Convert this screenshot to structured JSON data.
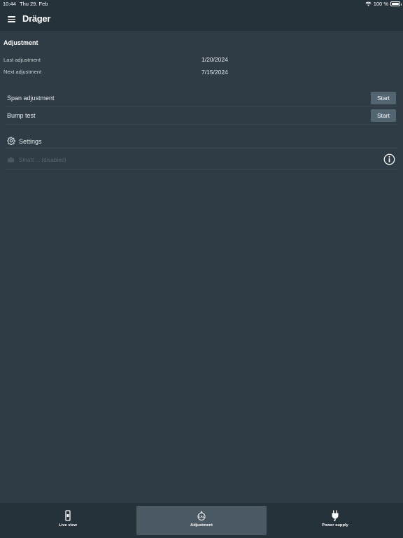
{
  "status_bar": {
    "time": "10:44",
    "date": "Thu 29. Feb",
    "battery": "100 %"
  },
  "app_bar": {
    "logo": "Dräger",
    "menu_icon": "menu-icon"
  },
  "adjustment": {
    "title": "Adjustment",
    "last_label": "Last adjustment",
    "last_value": "1/20/2024",
    "next_label": "Next adjustment",
    "next_value": "7/15/2024"
  },
  "actions": {
    "span": {
      "label": "Span adjustment",
      "button": "Start"
    },
    "bump": {
      "label": "Bump test",
      "button": "Start"
    }
  },
  "settings": {
    "label": "Settings",
    "icon": "gear-icon"
  },
  "disabled_option": {
    "label": "Smart ... (disabled)",
    "icon": "info-icon"
  },
  "bottom_nav": {
    "items": [
      {
        "label": "Live view",
        "icon": "device-icon"
      },
      {
        "label": "Adjustment",
        "icon": "cal-icon",
        "active": true
      },
      {
        "label": "Power supply",
        "icon": "plug-icon"
      }
    ]
  },
  "colors": {
    "background": "#2f3c45",
    "bar": "#26323a",
    "button": "#526571",
    "active_tab": "#4a5963"
  }
}
